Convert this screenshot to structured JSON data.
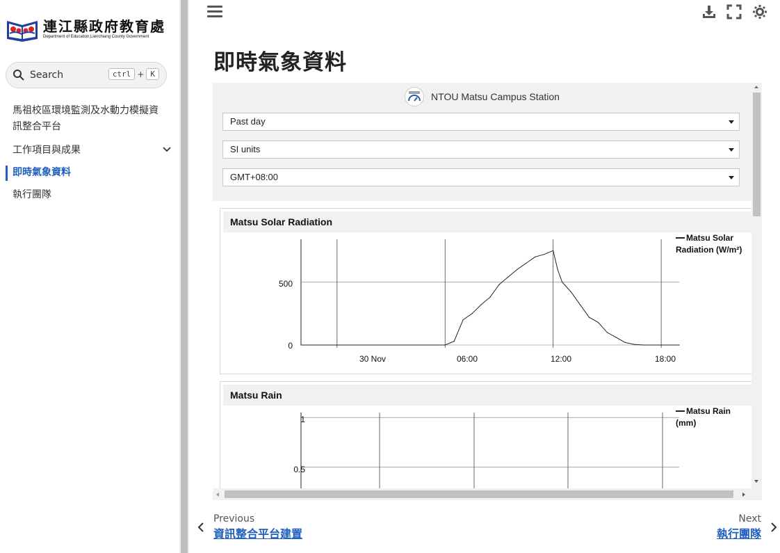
{
  "brand": {
    "title": "連江縣政府教育處",
    "subtitle": "Department of Education,Lienchiang County Government"
  },
  "search": {
    "label": "Search",
    "key1": "ctrl",
    "plus": "+",
    "key2": "K"
  },
  "nav": {
    "items": [
      {
        "label": "馬祖校區環境監測及水動力模擬資訊整合平台"
      },
      {
        "label": "工作項目與成果"
      },
      {
        "label": "即時氣象資料"
      },
      {
        "label": "執行團隊"
      }
    ]
  },
  "page": {
    "title": "即時氣象資料"
  },
  "station": {
    "name": "NTOU Matsu Campus Station",
    "period": "Past day",
    "units": "SI units",
    "timezone": "GMT+08:00"
  },
  "charts": {
    "solar": {
      "title": "Matsu Solar Radiation",
      "legend_line1": "Matsu Solar",
      "legend_line2": "Radiation (W/m²)",
      "y_ticks": [
        "500",
        "0"
      ],
      "x_ticks": [
        "30 Nov",
        "06:00",
        "12:00",
        "18:00"
      ]
    },
    "rain": {
      "title": "Matsu Rain",
      "legend_line1": "Matsu Rain",
      "legend_line2": "(mm)",
      "y_ticks": [
        "1",
        "0.5"
      ]
    }
  },
  "chart_data": [
    {
      "type": "line",
      "title": "Matsu Solar Radiation",
      "series": [
        {
          "name": "Matsu Solar Radiation (W/m²)",
          "x": [
            "22:00",
            "00:00",
            "02:00",
            "04:00",
            "06:00",
            "06:30",
            "07:00",
            "07:30",
            "08:00",
            "08:30",
            "09:00",
            "09:30",
            "10:00",
            "10:30",
            "11:00",
            "11:30",
            "12:00",
            "12:15",
            "12:30",
            "13:00",
            "13:30",
            "14:00",
            "14:30",
            "15:00",
            "15:30",
            "16:00",
            "16:30",
            "17:00",
            "18:00",
            "19:00"
          ],
          "y": [
            0,
            0,
            0,
            0,
            0,
            30,
            200,
            250,
            320,
            380,
            480,
            540,
            600,
            650,
            700,
            720,
            750,
            600,
            500,
            420,
            320,
            220,
            180,
            100,
            60,
            20,
            5,
            0,
            0,
            0
          ]
        }
      ],
      "xlabel": "",
      "ylabel": "",
      "y_ticks": [
        0,
        500
      ],
      "ylim": [
        0,
        840
      ],
      "x_ticks": [
        "30 Nov",
        "06:00",
        "12:00",
        "18:00"
      ],
      "grid": true,
      "legend": "top-right"
    },
    {
      "type": "line",
      "title": "Matsu Rain",
      "series": [
        {
          "name": "Matsu Rain (mm)",
          "x": [],
          "y": []
        }
      ],
      "xlabel": "",
      "ylabel": "",
      "y_ticks": [
        0.5,
        1
      ],
      "ylim": [
        0,
        1.05
      ],
      "grid": true,
      "legend": "top-right"
    }
  ],
  "footer": {
    "prev_label": "Previous",
    "prev_title": "資訊整合平台建置",
    "next_label": "Next",
    "next_title": "執行團隊"
  }
}
